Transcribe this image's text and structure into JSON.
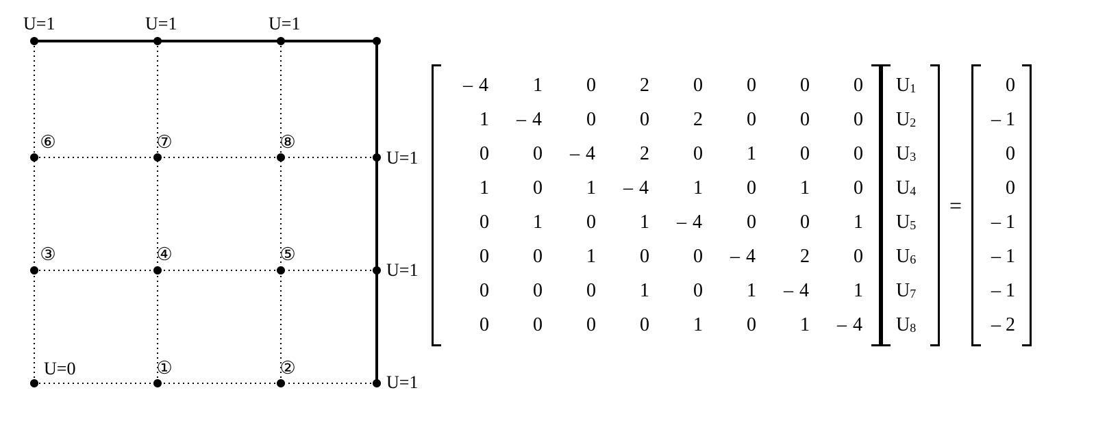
{
  "diagram": {
    "boundary_labels": {
      "top": [
        "U=1",
        "U=1",
        "U=1"
      ],
      "right": [
        "U=1",
        "U=1",
        "U=1"
      ],
      "bottom_left": "U=0"
    },
    "node_labels": [
      "①",
      "②",
      "③",
      "④",
      "⑤",
      "⑥",
      "⑦",
      "⑧"
    ],
    "grid": {
      "nx": 4,
      "ny": 4,
      "solid_edges": "top,right",
      "dotted_edges": "interior,left,bottom"
    }
  },
  "matrixA": [
    [
      "– 4",
      "1",
      "0",
      "2",
      "0",
      "0",
      "0",
      "0"
    ],
    [
      "1",
      "– 4",
      "0",
      "0",
      "2",
      "0",
      "0",
      "0"
    ],
    [
      "0",
      "0",
      "– 4",
      "2",
      "0",
      "1",
      "0",
      "0"
    ],
    [
      "1",
      "0",
      "1",
      "– 4",
      "1",
      "0",
      "1",
      "0"
    ],
    [
      "0",
      "1",
      "0",
      "1",
      "– 4",
      "0",
      "0",
      "1"
    ],
    [
      "0",
      "0",
      "1",
      "0",
      "0",
      "– 4",
      "2",
      "0"
    ],
    [
      "0",
      "0",
      "0",
      "1",
      "0",
      "1",
      "– 4",
      "1"
    ],
    [
      "0",
      "0",
      "0",
      "0",
      "1",
      "0",
      "1",
      "– 4"
    ]
  ],
  "vectorU": [
    "U_1",
    "U_2",
    "U_3",
    "U_4",
    "U_5",
    "U_6",
    "U_7",
    "U_8"
  ],
  "equals": "=",
  "vectorB": [
    "0",
    "– 1",
    "0",
    "0",
    "– 1",
    "– 1",
    "– 1",
    "– 2"
  ],
  "chart_data": {
    "type": "diagram",
    "description": "Finite-difference grid with 8 interior/symmetry nodes and resulting linear system A·U = b",
    "boundary_conditions": {
      "top": 1,
      "right": 1,
      "bottom_left_corner": 0
    },
    "nodes": [
      {
        "id": 1,
        "grid_ij": [
          1,
          1
        ]
      },
      {
        "id": 2,
        "grid_ij": [
          2,
          1
        ]
      },
      {
        "id": 3,
        "grid_ij": [
          0,
          2
        ]
      },
      {
        "id": 4,
        "grid_ij": [
          1,
          2
        ]
      },
      {
        "id": 5,
        "grid_ij": [
          2,
          2
        ]
      },
      {
        "id": 6,
        "grid_ij": [
          0,
          3
        ]
      },
      {
        "id": 7,
        "grid_ij": [
          1,
          3
        ]
      },
      {
        "id": 8,
        "grid_ij": [
          2,
          3
        ]
      }
    ],
    "A": [
      [
        -4,
        1,
        0,
        2,
        0,
        0,
        0,
        0
      ],
      [
        1,
        -4,
        0,
        0,
        2,
        0,
        0,
        0
      ],
      [
        0,
        0,
        -4,
        2,
        0,
        1,
        0,
        0
      ],
      [
        1,
        0,
        1,
        -4,
        1,
        0,
        1,
        0
      ],
      [
        0,
        1,
        0,
        1,
        -4,
        0,
        0,
        1
      ],
      [
        0,
        0,
        1,
        0,
        0,
        -4,
        2,
        0
      ],
      [
        0,
        0,
        0,
        1,
        0,
        1,
        -4,
        1
      ],
      [
        0,
        0,
        0,
        0,
        1,
        0,
        1,
        -4
      ]
    ],
    "b": [
      0,
      -1,
      0,
      0,
      -1,
      -1,
      -1,
      -2
    ]
  }
}
